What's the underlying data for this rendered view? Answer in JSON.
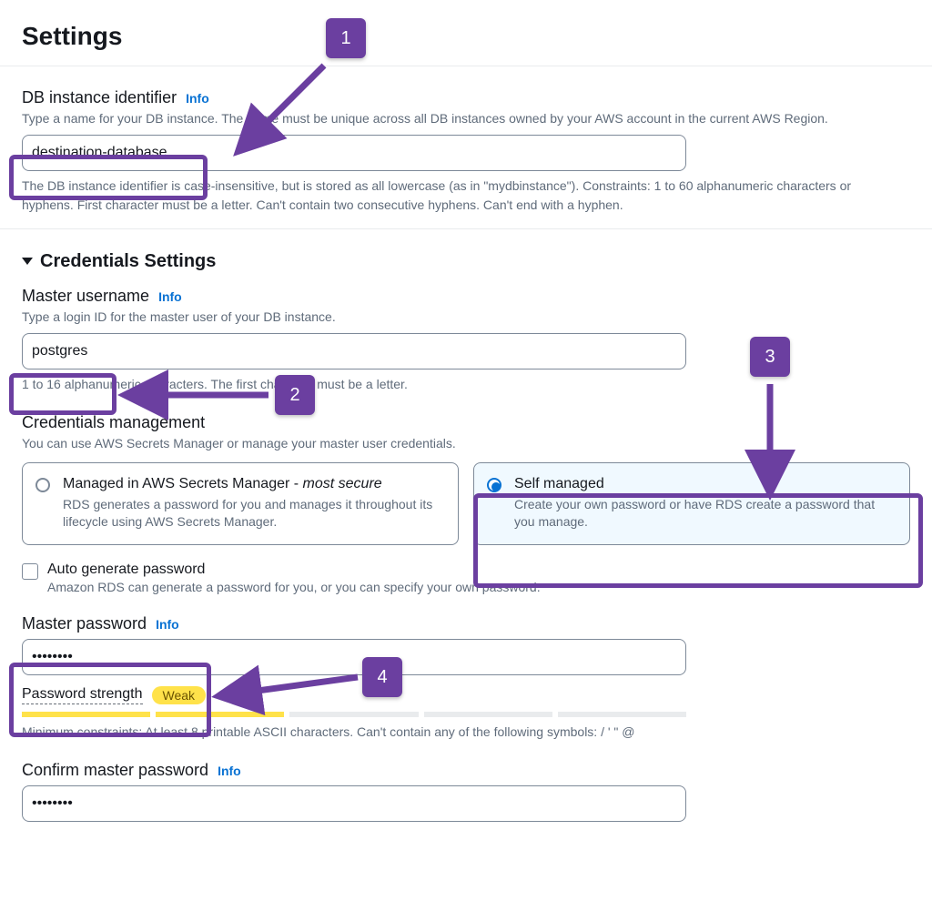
{
  "page_title": "Settings",
  "db_identifier": {
    "label": "DB instance identifier",
    "info": "Info",
    "help": "Type a name for your DB instance. The name must be unique across all DB instances owned by your AWS account in the current AWS Region.",
    "value": "destination-database",
    "constraints": "The DB instance identifier is case-insensitive, but is stored as all lowercase (as in \"mydbinstance\"). Constraints: 1 to 60 alphanumeric characters or hyphens. First character must be a letter. Can't contain two consecutive hyphens. Can't end with a hyphen."
  },
  "credentials": {
    "section_title": "Credentials Settings",
    "master_username": {
      "label": "Master username",
      "info": "Info",
      "help": "Type a login ID for the master user of your DB instance.",
      "value": "postgres",
      "constraints": "1 to 16 alphanumeric characters. The first character must be a letter."
    },
    "management": {
      "label": "Credentials management",
      "help": "You can use AWS Secrets Manager or manage your master user credentials.",
      "options": {
        "secrets_manager": {
          "title_prefix": "Managed in AWS Secrets Manager - ",
          "title_em": "most secure",
          "desc": "RDS generates a password for you and manages it throughout its lifecycle using AWS Secrets Manager."
        },
        "self_managed": {
          "title": "Self managed",
          "desc": "Create your own password or have RDS create a password that you manage."
        }
      }
    },
    "auto_generate": {
      "label": "Auto generate password",
      "desc": "Amazon RDS can generate a password for you, or you can specify your own password."
    },
    "master_password": {
      "label": "Master password",
      "info": "Info",
      "value": "••••••••"
    },
    "strength": {
      "label": "Password strength",
      "badge": "Weak",
      "constraints": "Minimum constraints: At least 8 printable ASCII characters. Can't contain any of the following symbols: / ' \" @"
    },
    "confirm_password": {
      "label": "Confirm master password",
      "info": "Info",
      "value": "••••••••"
    }
  },
  "callouts": {
    "c1": "1",
    "c2": "2",
    "c3": "3",
    "c4": "4"
  }
}
